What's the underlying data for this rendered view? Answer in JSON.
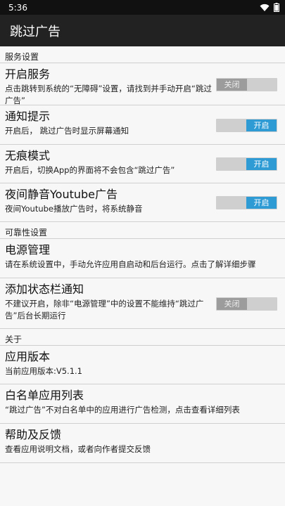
{
  "status": {
    "time": "5:36"
  },
  "app": {
    "title": "跳过广告"
  },
  "sections": {
    "service": "服务设置",
    "reliability": "可靠性设置",
    "about": "关于"
  },
  "toggle_labels": {
    "on": "开启",
    "off": "关闭"
  },
  "items": {
    "enable_service": {
      "title": "开启服务",
      "subtitle": "点击跳转到系统的“无障碍”设置，请找到并手动开启“跳过广告”",
      "state": "off"
    },
    "notify": {
      "title": "通知提示",
      "subtitle": "开启后， 跳过广告时显示屏幕通知",
      "state": "on"
    },
    "incognito": {
      "title": "无痕模式",
      "subtitle": "开启后，切换App的界面将不会包含“跳过广告”",
      "state": "on"
    },
    "youtube_mute": {
      "title": "夜间静音Youtube广告",
      "subtitle": "夜间Youtube播放广告时，将系统静音",
      "state": "on"
    },
    "power": {
      "title": "电源管理",
      "subtitle": "请在系统设置中，手动允许应用自启动和后台运行。点击了解详细步骤"
    },
    "statusbar_notify": {
      "title": "添加状态栏通知",
      "subtitle": "不建议开启，除非“电源管理”中的设置不能维持“跳过广告”后台长期运行",
      "state": "off"
    },
    "version": {
      "title": "应用版本",
      "subtitle": "当前应用版本:V5.1.1"
    },
    "whitelist": {
      "title": "白名单应用列表",
      "subtitle": "“跳过广告”不对白名单中的应用进行广告检测，点击查看详细列表"
    },
    "help": {
      "title": "帮助及反馈",
      "subtitle": "查看应用说明文档，或者向作者提交反馈"
    }
  },
  "colors": {
    "accent": "#2f9bd5",
    "appbar": "#222222",
    "statusbar": "#111111"
  }
}
